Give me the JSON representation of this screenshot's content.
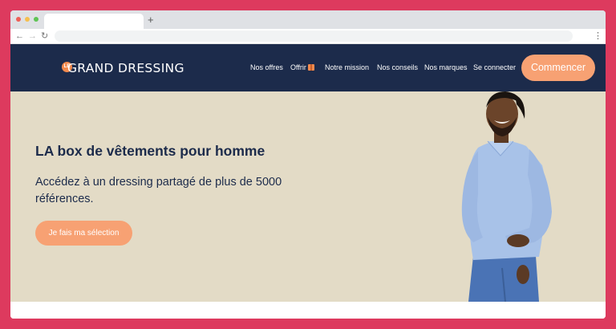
{
  "browser": {
    "new_tab_label": "+",
    "back_icon": "arrow-left-icon",
    "forward_icon": "arrow-right-icon",
    "reload_icon": "reload-icon",
    "menu_icon": "kebab-menu-icon"
  },
  "site": {
    "logo": {
      "badge": "LE",
      "text": "GRAND DRESSING"
    },
    "nav": [
      {
        "label": "Nos offres"
      },
      {
        "label": "Offrir"
      },
      {
        "label": "Notre mission"
      },
      {
        "label": "Nos conseils"
      },
      {
        "label": "Nos marques"
      },
      {
        "label": "Se connecter"
      }
    ],
    "cta_label": "Commencer"
  },
  "hero": {
    "title": "LA box de vêtements pour homme",
    "subtitle": "Accédez à un dressing partagé de plus de 5000 références.",
    "button_label": "Je fais ma sélection"
  },
  "colors": {
    "background": "#dd3a5e",
    "header": "#1c2b4b",
    "accent": "#f7a173",
    "hero_bg": "#e3dbc6"
  }
}
